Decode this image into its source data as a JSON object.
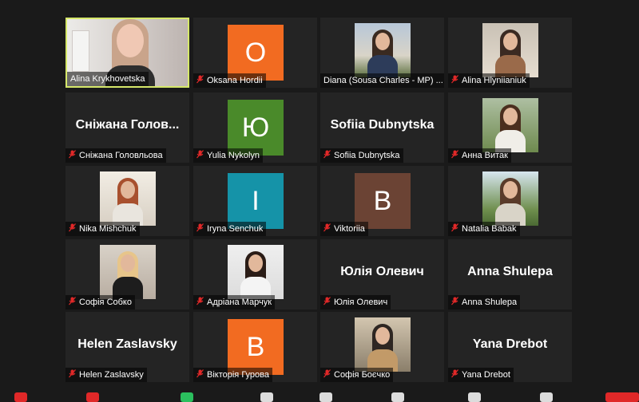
{
  "participants": [
    {
      "name": "Alina Krykhovetska",
      "display": "video-self",
      "muted": false
    },
    {
      "name": "Oksana Hordii",
      "display": "avatar",
      "initial": "O",
      "color": "#f26b21",
      "muted": true
    },
    {
      "name": "Diana (Sousa Charles - MP) ...",
      "display": "photo",
      "muted": false
    },
    {
      "name": "Alina Hlyniianiuk",
      "display": "photo",
      "muted": true
    },
    {
      "name": "Сніжана Головльова",
      "display": "text",
      "big": "Сніжана Голов...",
      "muted": true
    },
    {
      "name": "Yulia Nykolyn",
      "display": "avatar",
      "initial": "Ю",
      "color": "#4a8a2a",
      "muted": true
    },
    {
      "name": "Sofiia Dubnytska",
      "display": "text",
      "big": "Sofiia Dubnytska",
      "muted": true
    },
    {
      "name": "Анна Витак",
      "display": "photo",
      "muted": true
    },
    {
      "name": "Nika Mishchuk",
      "display": "photo",
      "muted": true
    },
    {
      "name": "Iryna Senchuk",
      "display": "avatar",
      "initial": "I",
      "color": "#1593a8",
      "muted": true
    },
    {
      "name": "Viktoriia",
      "display": "avatar",
      "initial": "B",
      "color": "#6b4334",
      "muted": true
    },
    {
      "name": "Natalia Babak",
      "display": "photo",
      "muted": true
    },
    {
      "name": "Софія Собко",
      "display": "photo",
      "muted": true
    },
    {
      "name": "Адріана Марчук",
      "display": "photo",
      "muted": true
    },
    {
      "name": "Юлія Олевич",
      "display": "text",
      "big": "Юлія Олевич",
      "muted": true
    },
    {
      "name": "Anna Shulepa",
      "display": "text",
      "big": "Anna Shulepa",
      "muted": true
    },
    {
      "name": "Helen Zaslavsky",
      "display": "text",
      "big": "Helen Zaslavsky",
      "muted": true
    },
    {
      "name": "Вікторія Гурова",
      "display": "avatar",
      "initial": "B",
      "color": "#f26b21",
      "muted": true
    },
    {
      "name": "Софія Боєчко",
      "display": "photo",
      "muted": true
    },
    {
      "name": "Yana Drebot",
      "display": "text",
      "big": "Yana Drebot",
      "muted": true
    }
  ],
  "colors": {
    "active_border": "#d6e86a",
    "muted_mic": "#e02828",
    "tile_bg": "#242424"
  },
  "icons": {
    "muted": "mic-muted-icon"
  }
}
